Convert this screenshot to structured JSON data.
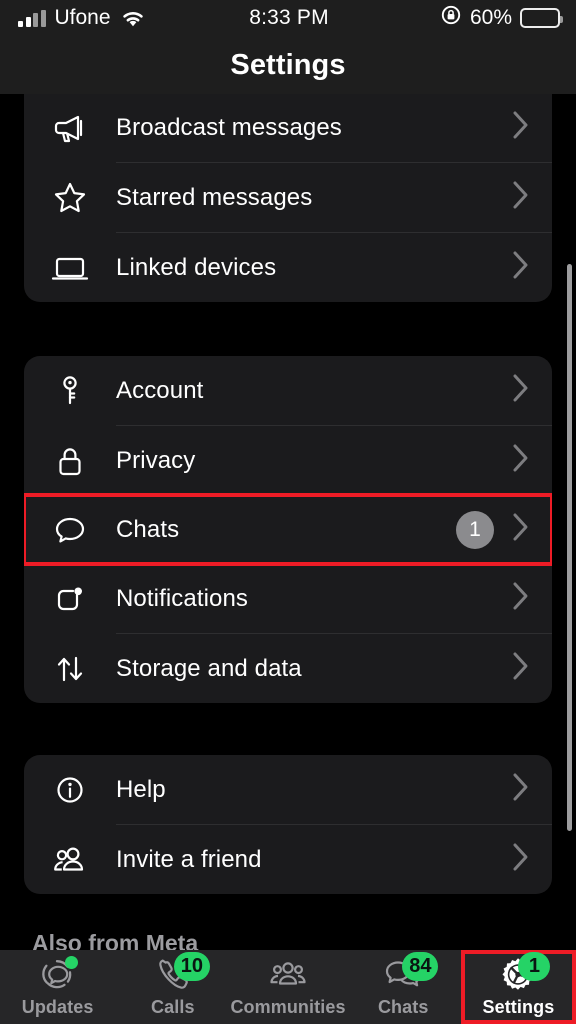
{
  "status_bar": {
    "carrier": "Ufone",
    "time": "8:33 PM",
    "battery_percent": "60%",
    "battery_level": 60,
    "icons": [
      "signal-bars-icon",
      "wifi-icon",
      "rotation-lock-icon",
      "battery-icon"
    ]
  },
  "header": {
    "title": "Settings"
  },
  "sections": [
    {
      "id": "group-one",
      "rows": [
        {
          "icon": "megaphone-icon",
          "label": "Broadcast messages",
          "badge": null,
          "chevron": true
        },
        {
          "icon": "star-icon",
          "label": "Starred messages",
          "badge": null,
          "chevron": true
        },
        {
          "icon": "laptop-icon",
          "label": "Linked devices",
          "badge": null,
          "chevron": true
        }
      ]
    },
    {
      "id": "group-two",
      "rows": [
        {
          "icon": "key-icon",
          "label": "Account",
          "badge": null,
          "chevron": true
        },
        {
          "icon": "lock-icon",
          "label": "Privacy",
          "badge": null,
          "chevron": true
        },
        {
          "icon": "chat-bubble-icon",
          "label": "Chats",
          "badge": "1",
          "chevron": true,
          "highlighted": true
        },
        {
          "icon": "notification-square-icon",
          "label": "Notifications",
          "badge": null,
          "chevron": true
        },
        {
          "icon": "arrows-up-down-icon",
          "label": "Storage and data",
          "badge": null,
          "chevron": true
        }
      ]
    },
    {
      "id": "group-three",
      "rows": [
        {
          "icon": "info-circle-icon",
          "label": "Help",
          "badge": null,
          "chevron": true
        },
        {
          "icon": "people-icon",
          "label": "Invite a friend",
          "badge": null,
          "chevron": true
        }
      ]
    }
  ],
  "footer_section_label": "Also from Meta",
  "tab_bar": {
    "tabs": [
      {
        "id": "updates",
        "label": "Updates",
        "icon": "updates-ring-icon",
        "badge": null,
        "dot": true,
        "active": false
      },
      {
        "id": "calls",
        "label": "Calls",
        "icon": "phone-icon",
        "badge": "10",
        "dot": false,
        "active": false
      },
      {
        "id": "communities",
        "label": "Communities",
        "icon": "communities-icon",
        "badge": null,
        "dot": false,
        "active": false
      },
      {
        "id": "chats",
        "label": "Chats",
        "icon": "chats-bubbles-icon",
        "badge": "84",
        "dot": false,
        "active": false
      },
      {
        "id": "settings",
        "label": "Settings",
        "icon": "gear-icon",
        "badge": "1",
        "dot": false,
        "active": true,
        "highlighted": true
      }
    ]
  },
  "colors": {
    "page_background": "#000000",
    "card_background": "#1b1b1d",
    "header_background": "#1e1e1e",
    "tab_bar_background": "#262628",
    "accent_green": "#25d366",
    "highlight_red": "#ee1c26",
    "badge_gray": "#8b8b8e",
    "text_primary": "#ffffff",
    "text_secondary": "#9a9a9e"
  }
}
